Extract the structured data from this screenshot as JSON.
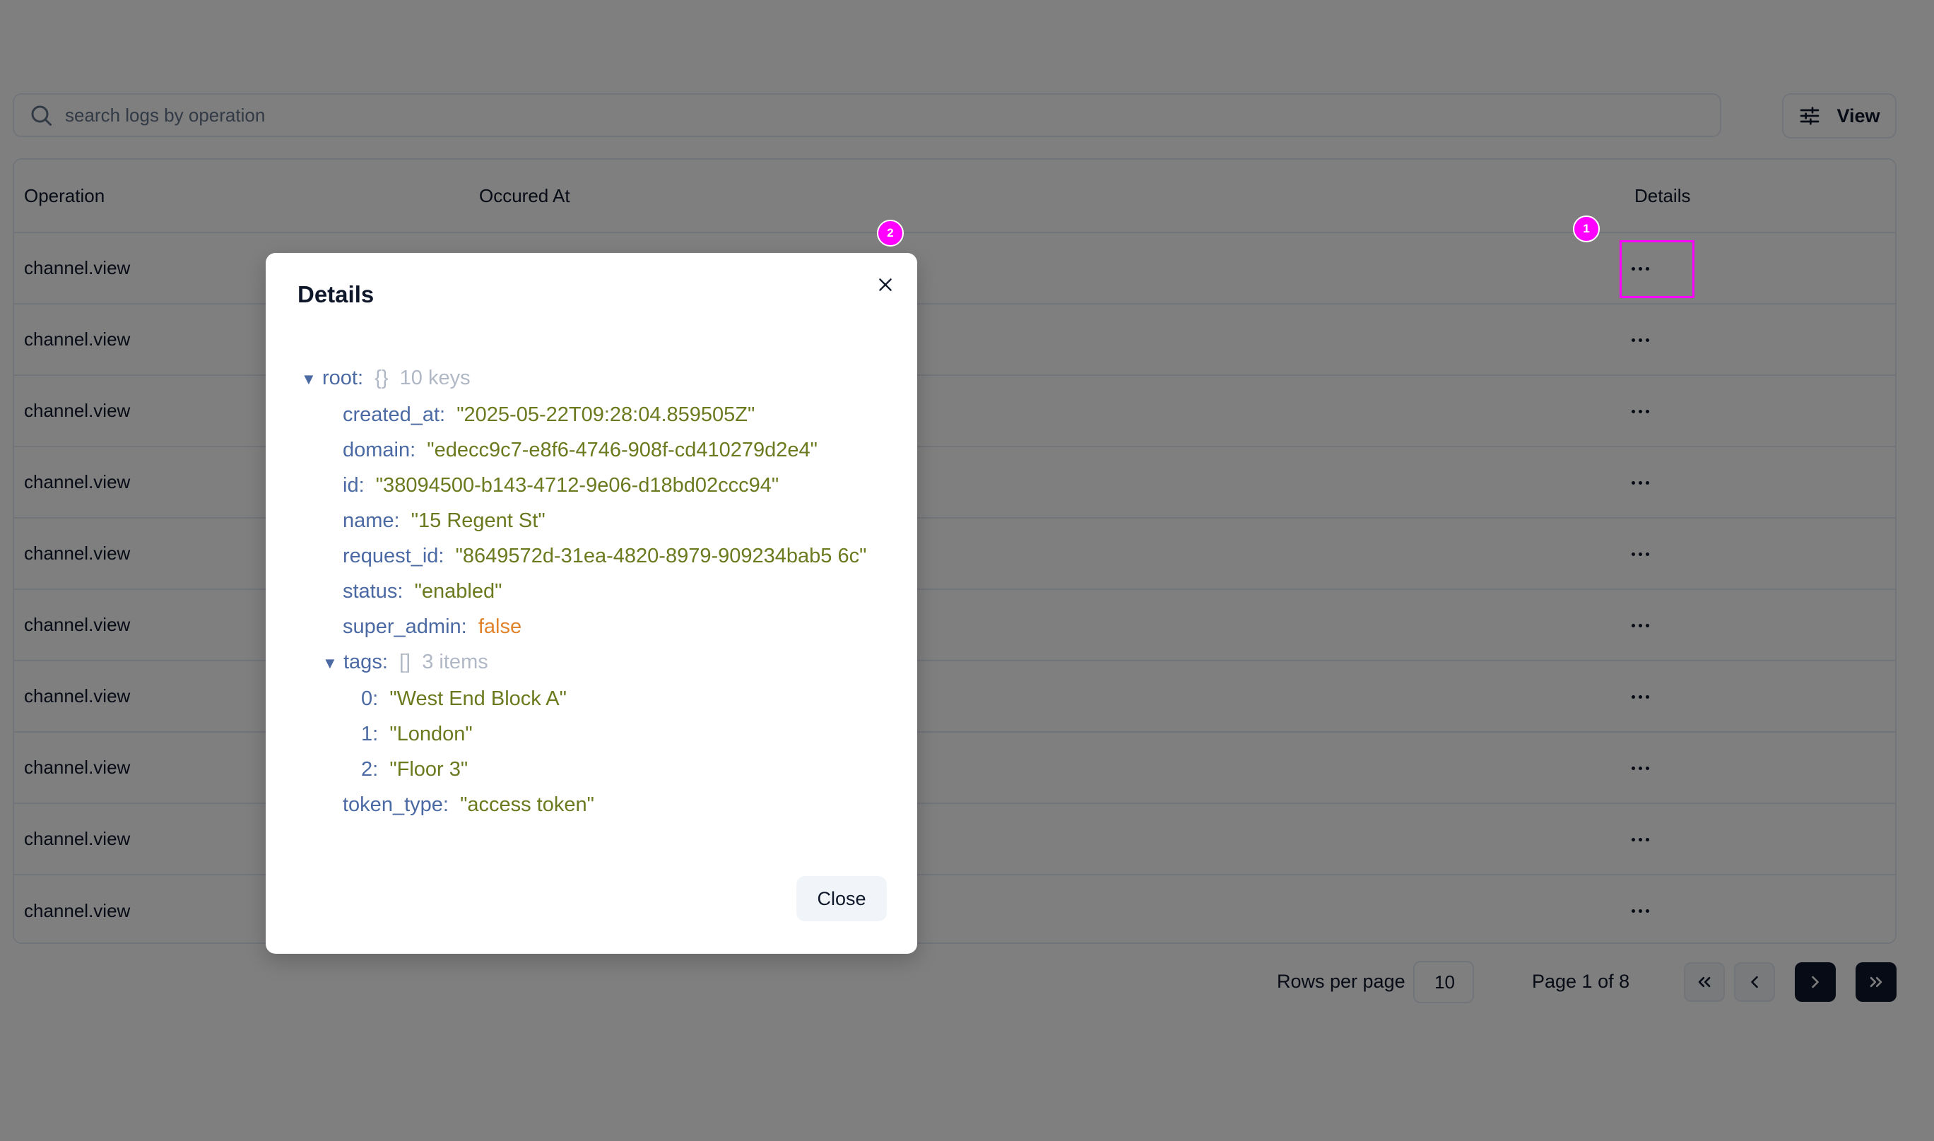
{
  "search": {
    "placeholder": "search logs by operation",
    "value": ""
  },
  "toolbar": {
    "view_label": "View"
  },
  "table": {
    "columns": {
      "operation": "Operation",
      "occurred_at": "Occured At",
      "details": "Details"
    },
    "rows": [
      {
        "operation": "channel.view"
      },
      {
        "operation": "channel.view"
      },
      {
        "operation": "channel.view"
      },
      {
        "operation": "channel.view"
      },
      {
        "operation": "channel.view"
      },
      {
        "operation": "channel.view"
      },
      {
        "operation": "channel.view"
      },
      {
        "operation": "channel.view"
      },
      {
        "operation": "channel.view"
      },
      {
        "operation": "channel.view"
      }
    ]
  },
  "pagination": {
    "rows_per_page_label": "Rows per page",
    "rows_per_page_value": "10",
    "page_label": "Page 1 of 8"
  },
  "annotations": {
    "mark1": "1",
    "mark2": "2"
  },
  "dialog": {
    "title": "Details",
    "close_label": "Close",
    "tree": {
      "root_key": "root:",
      "root_brace": "{}",
      "root_count": "10 keys",
      "fields": {
        "created_at": {
          "key": "created_at:",
          "value": "\"2025-05-22T09:28:04.859505Z\""
        },
        "domain": {
          "key": "domain:",
          "value": "\"edecc9c7-e8f6-4746-908f-cd410279d2e4\""
        },
        "id": {
          "key": "id:",
          "value": "\"38094500-b143-4712-9e06-d18bd02ccc94\""
        },
        "name": {
          "key": "name:",
          "value": "\"15 Regent St\""
        },
        "request_id": {
          "key": "request_id:",
          "value": "\"8649572d-31ea-4820-8979-909234bab5 6c\""
        },
        "status": {
          "key": "status:",
          "value": "\"enabled\""
        },
        "super_admin": {
          "key": "super_admin:",
          "value": "false"
        },
        "token_type": {
          "key": "token_type:",
          "value": "\"access token\""
        }
      },
      "tags": {
        "key": "tags:",
        "brace": "[]",
        "count": "3 items",
        "items": [
          {
            "key": "0:",
            "value": "\"West End Block A\""
          },
          {
            "key": "1:",
            "value": "\"London\""
          },
          {
            "key": "2:",
            "value": "\"Floor 3\""
          }
        ]
      }
    }
  },
  "colors": {
    "overlay": "#000000",
    "annotation": "#ff00ff",
    "json_key": "#4b6aa3",
    "json_string": "#6b7a1f",
    "json_boolean": "#e0832a",
    "pagination_active": "#0f172a"
  },
  "icons": {
    "search": "search-icon",
    "view": "sliders-icon",
    "more": "more-horizontal-icon",
    "close": "close-icon",
    "first": "chevrons-left-icon",
    "prev": "chevron-left-icon",
    "next": "chevron-right-icon",
    "last": "chevrons-right-icon"
  }
}
